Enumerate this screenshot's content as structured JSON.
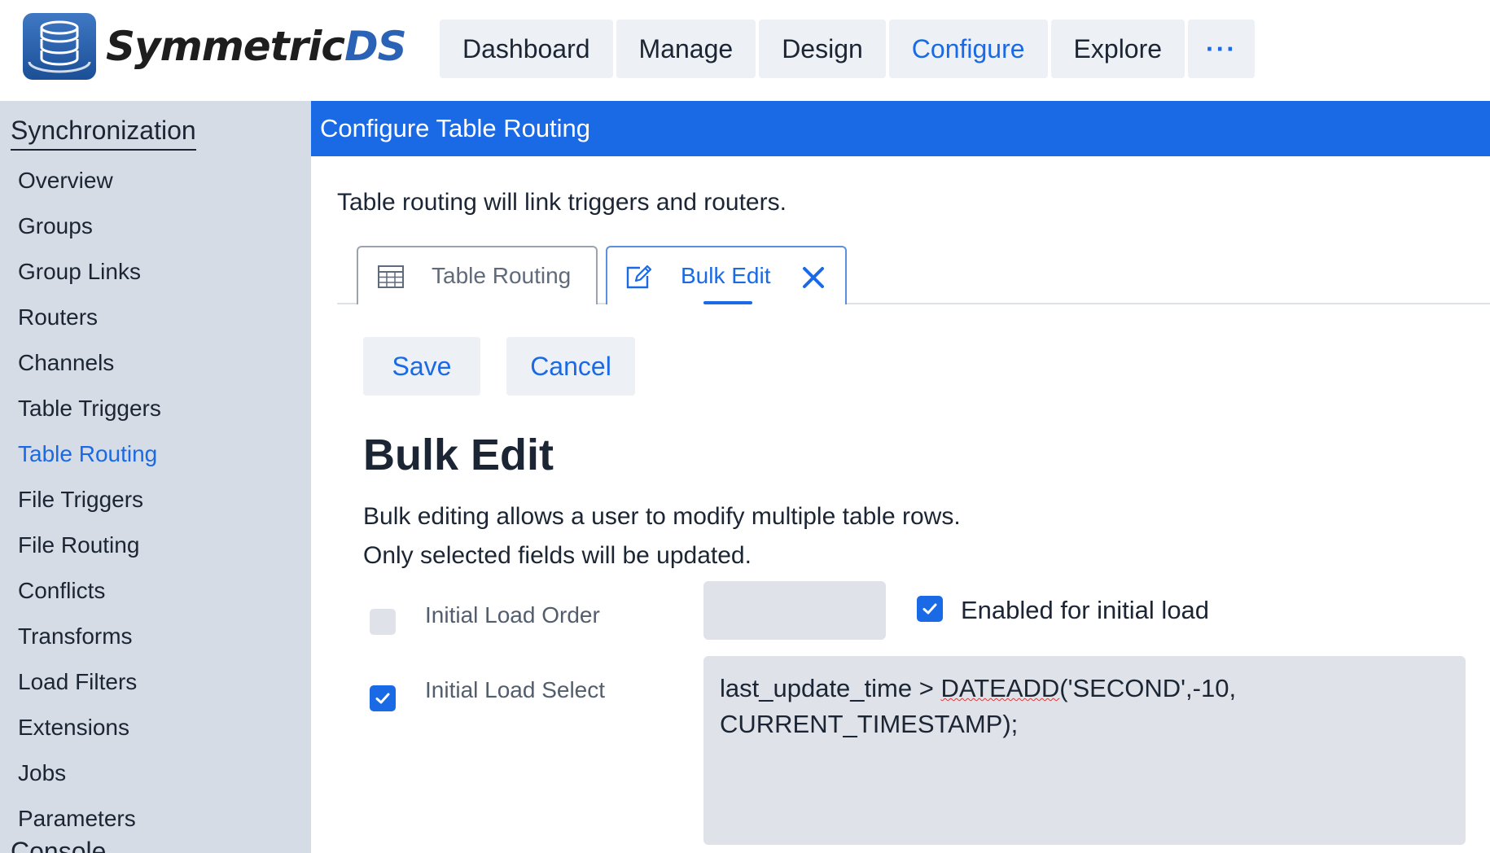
{
  "brand": {
    "name_part1": "Symmetric",
    "name_part2": "DS"
  },
  "topnav": {
    "items": [
      {
        "label": "Dashboard",
        "active": false
      },
      {
        "label": "Manage",
        "active": false
      },
      {
        "label": "Design",
        "active": false
      },
      {
        "label": "Configure",
        "active": true
      },
      {
        "label": "Explore",
        "active": false
      }
    ],
    "more_label": "···"
  },
  "sidebar": {
    "section": "Synchronization",
    "items": [
      {
        "label": "Overview"
      },
      {
        "label": "Groups"
      },
      {
        "label": "Group Links"
      },
      {
        "label": "Routers"
      },
      {
        "label": "Channels"
      },
      {
        "label": "Table Triggers"
      },
      {
        "label": "Table Routing",
        "active": true
      },
      {
        "label": "File Triggers"
      },
      {
        "label": "File Routing"
      },
      {
        "label": "Conflicts"
      },
      {
        "label": "Transforms"
      },
      {
        "label": "Load Filters"
      },
      {
        "label": "Extensions"
      },
      {
        "label": "Jobs"
      },
      {
        "label": "Parameters"
      }
    ],
    "next_section": "Console"
  },
  "page": {
    "header": "Configure Table Routing",
    "description": "Table routing will link triggers and routers."
  },
  "tabs": [
    {
      "label": "Table Routing",
      "icon": "table-grid-icon",
      "selected": false
    },
    {
      "label": "Bulk Edit",
      "icon": "edit-pencil-icon",
      "selected": true,
      "closable": true
    }
  ],
  "toolbar": {
    "save_label": "Save",
    "cancel_label": "Cancel"
  },
  "bulk_edit": {
    "title": "Bulk Edit",
    "line1": "Bulk editing allows a user to modify multiple table rows.",
    "line2": "Only selected fields will be updated.",
    "fields": {
      "initial_load_order": {
        "label": "Initial Load Order",
        "checked": false,
        "value": ""
      },
      "enabled_initial_load": {
        "label": "Enabled for initial load",
        "checked": true
      },
      "initial_load_select": {
        "label": "Initial Load Select",
        "checked": true,
        "value_prefix": "last_update_time > ",
        "value_spell": "DATEADD",
        "value_suffix": "('SECOND',-10,\nCURRENT_TIMESTAMP);"
      }
    }
  },
  "colors": {
    "accent": "#1a6ae6",
    "sidebar_bg": "#d6dce5",
    "input_bg": "#dfe3e9"
  }
}
